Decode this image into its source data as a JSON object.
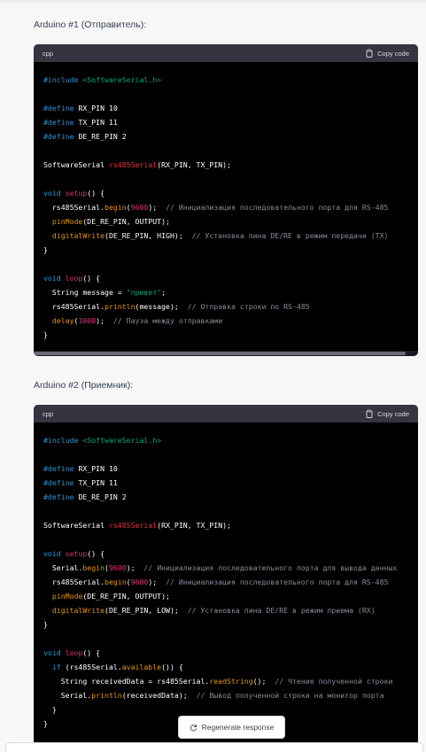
{
  "labels": {
    "sender": "Arduino #1 (Отправитель):",
    "receiver": "Arduino #2 (Приемник):"
  },
  "block1": {
    "lang": "cpp",
    "copy": "Copy code",
    "lines": {
      "l1a": "#include",
      "l1b": " <SoftwareSerial.h>",
      "l2a": "#define",
      "l2b": " RX_PIN 10",
      "l3a": "#define",
      "l3b": " TX_PIN 11",
      "l4a": "#define",
      "l4b": " DE_RE_PIN 2",
      "l5a": "SoftwareSerial ",
      "l5b": "rs485Serial",
      "l5c": "(RX_PIN, TX_PIN);",
      "l6a": "void",
      "l6b": " ",
      "l6c": "setup",
      "l6d": "() {",
      "l7a": "  rs485Serial.",
      "l7b": "begin",
      "l7c": "(",
      "l7d": "9600",
      "l7e": ");  ",
      "l7f": "// Инициализация последовательного порта для RS-485",
      "l8a": "  ",
      "l8b": "pinMode",
      "l8c": "(DE_RE_PIN, OUTPUT);",
      "l9a": "  ",
      "l9b": "digitalWrite",
      "l9c": "(DE_RE_PIN, HIGH);  ",
      "l9d": "// Установка пина DE/RE в режим передачи (TX)",
      "l10": "}",
      "l11a": "void",
      "l11b": " ",
      "l11c": "loop",
      "l11d": "() {",
      "l12a": "  String message = ",
      "l12b": "\"привет\"",
      "l12c": ";",
      "l13a": "  rs485Serial.",
      "l13b": "println",
      "l13c": "(message);  ",
      "l13d": "// Отправка строки по RS-485",
      "l14a": "  ",
      "l14b": "delay",
      "l14c": "(",
      "l14d": "1000",
      "l14e": ");  ",
      "l14f": "// Пауза между отправками",
      "l15": "}"
    }
  },
  "block2": {
    "lang": "cpp",
    "copy": "Copy code",
    "lines": {
      "l1a": "#include",
      "l1b": " <SoftwareSerial.h>",
      "l2a": "#define",
      "l2b": " RX_PIN 10",
      "l3a": "#define",
      "l3b": " TX_PIN 11",
      "l4a": "#define",
      "l4b": " DE_RE_PIN 2",
      "l5a": "SoftwareSerial ",
      "l5b": "rs485Serial",
      "l5c": "(RX_PIN, TX_PIN);",
      "l6a": "void",
      "l6b": " ",
      "l6c": "setup",
      "l6d": "() {",
      "l7a": "  Serial.",
      "l7b": "begin",
      "l7c": "(",
      "l7d": "9600",
      "l7e": ");  ",
      "l7f": "// Инициализация последовательного порта для вывода данных",
      "l8a": "  rs485Serial.",
      "l8b": "begin",
      "l8c": "(",
      "l8d": "9600",
      "l8e": ");  ",
      "l8f": "// Инициализация последовательного порта для RS-485",
      "l9a": "  ",
      "l9b": "pinMode",
      "l9c": "(DE_RE_PIN, OUTPUT);",
      "l10a": "  ",
      "l10b": "digitalWrite",
      "l10c": "(DE_RE_PIN, LOW);  ",
      "l10d": "// Установка пина DE/RE в режим приема (RX)",
      "l11": "}",
      "l12a": "void",
      "l12b": " ",
      "l12c": "loop",
      "l12d": "() {",
      "l13a": "  ",
      "l13b": "if",
      "l13c": " (rs485Serial.",
      "l13d": "available",
      "l13e": "()) {",
      "l14a": "    String receivedData = rs485Serial.",
      "l14b": "readString",
      "l14c": "();  ",
      "l14d": "// Чтение полученной строки",
      "l15a": "    Serial.",
      "l15b": "println",
      "l15c": "(receivedData);  ",
      "l15d": "// Вывод полученной строки на монитор порта",
      "l16": "  }",
      "l17": "}"
    }
  },
  "regenerate": "Regenerate response",
  "icons": {
    "copy": "clipboard-icon",
    "regenerate": "refresh-icon"
  }
}
